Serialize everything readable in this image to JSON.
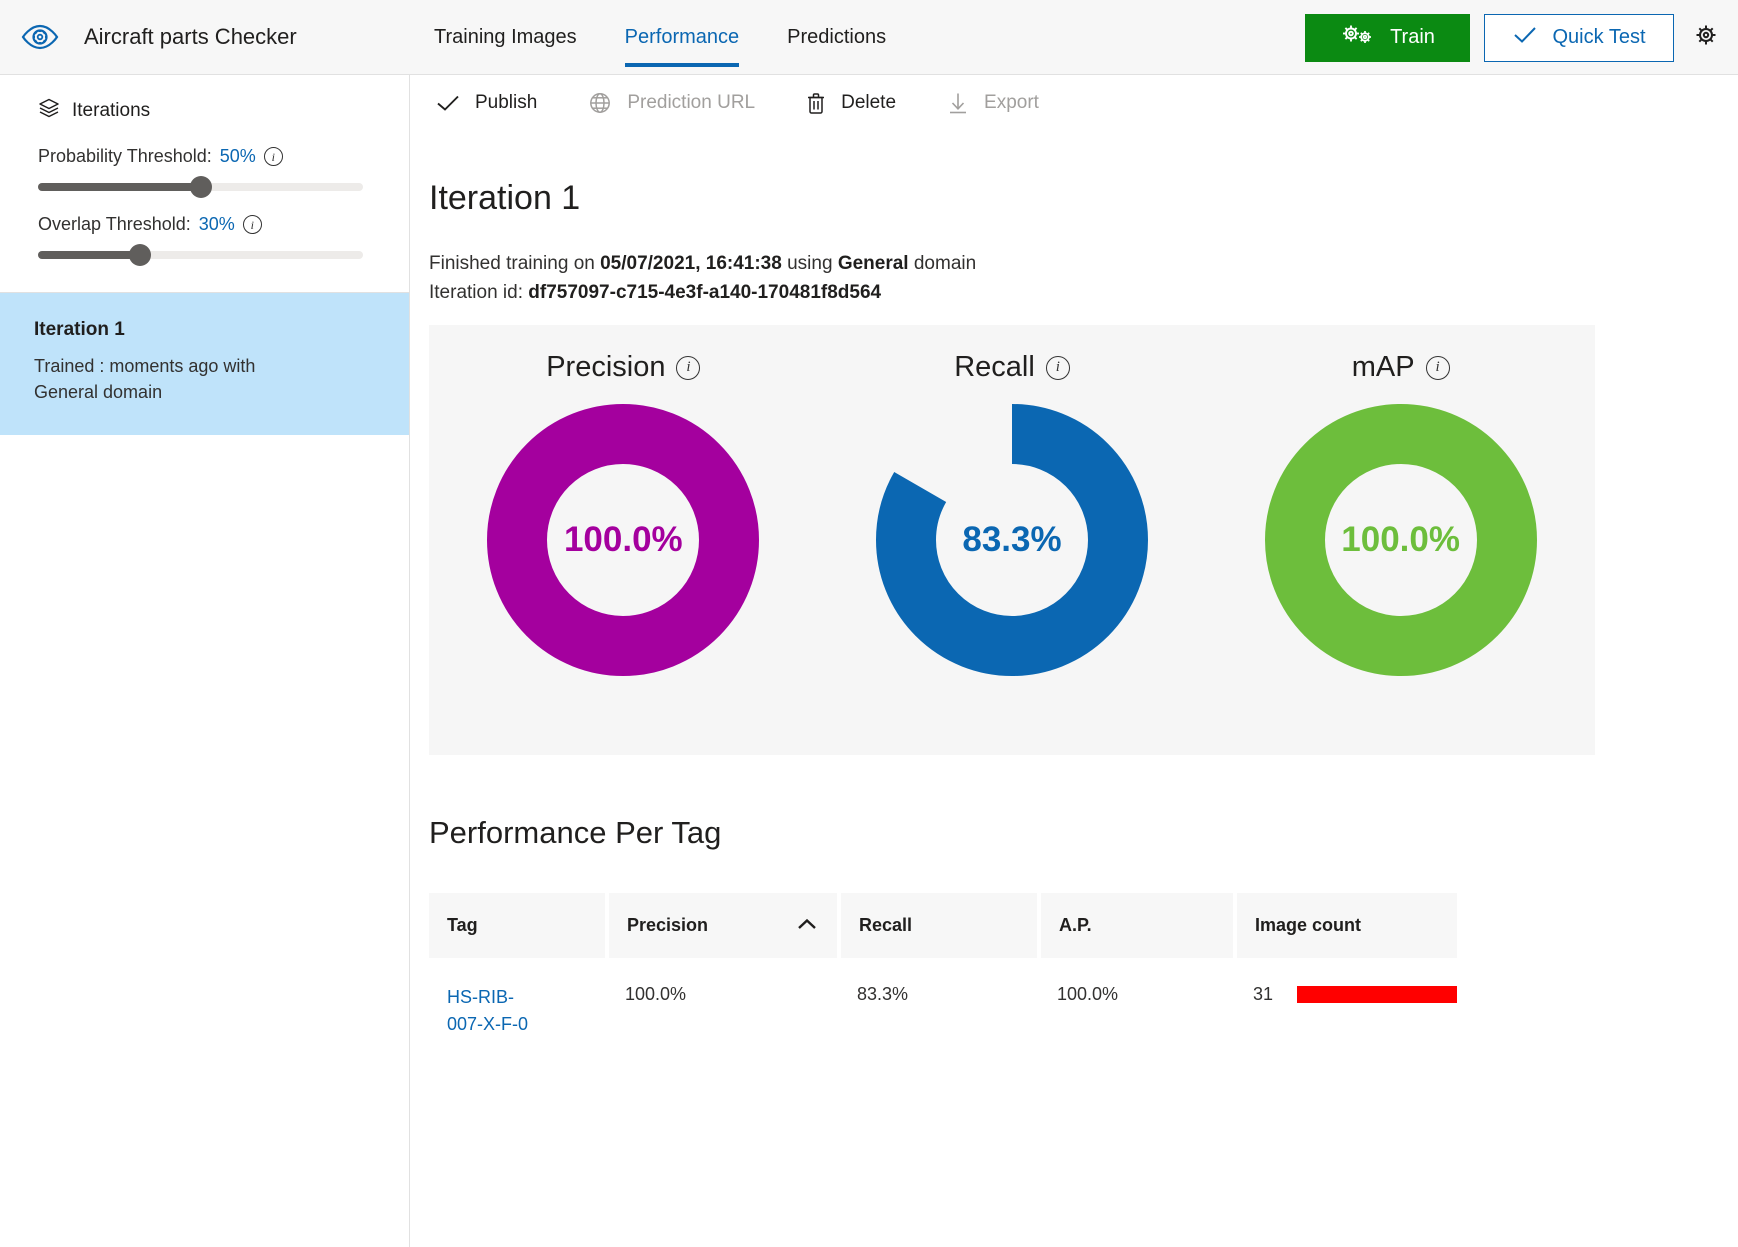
{
  "header": {
    "logo_icon": "eye-gear-icon",
    "project_title": "Aircraft parts Checker",
    "tabs": [
      {
        "label": "Training Images",
        "active": false
      },
      {
        "label": "Performance",
        "active": true
      },
      {
        "label": "Predictions",
        "active": false
      }
    ],
    "train_button": {
      "label": "Train",
      "icon": "gears-icon",
      "color": "#0b8a12"
    },
    "quick_test_button": {
      "label": "Quick Test",
      "icon": "checkmark-icon",
      "color": "#0b67b2"
    },
    "settings_icon": "gear-icon"
  },
  "sidebar": {
    "title": "Iterations",
    "title_icon": "layers-icon",
    "probability": {
      "label": "Probability Threshold:",
      "value": "50%",
      "percent": 50,
      "info_icon": "info-icon"
    },
    "overlap": {
      "label": "Overlap Threshold:",
      "value": "30%",
      "percent": 30,
      "info_icon": "info-icon"
    },
    "iterations": [
      {
        "name": "Iteration 1",
        "subtitle": "Trained : moments ago with General domain",
        "selected": true
      }
    ]
  },
  "toolbar": {
    "publish": {
      "label": "Publish",
      "icon": "checkmark-icon",
      "disabled": false
    },
    "prediction_url": {
      "label": "Prediction URL",
      "icon": "globe-icon",
      "disabled": true
    },
    "delete": {
      "label": "Delete",
      "icon": "trash-icon",
      "disabled": false
    },
    "export": {
      "label": "Export",
      "icon": "download-icon",
      "disabled": true
    }
  },
  "main": {
    "page_title": "Iteration 1",
    "finished_prefix": "Finished training on ",
    "finished_date": "05/07/2021, 16:41:38",
    "finished_mid": " using ",
    "domain": "General",
    "finished_suffix": " domain",
    "iteration_id_label": "Iteration id: ",
    "iteration_id": "df757097-c715-4e3f-a140-170481f8d564",
    "section_title": "Performance Per Tag"
  },
  "chart_data": [
    {
      "type": "pie",
      "title": "Precision",
      "value": 100.0,
      "value_label": "100.0%",
      "color": "#A4009E",
      "track_color": "#f6f6f6",
      "info_icon": "info-icon"
    },
    {
      "type": "pie",
      "title": "Recall",
      "value": 83.3,
      "value_label": "83.3%",
      "color": "#0b67b2",
      "track_color": "#f6f6f6",
      "info_icon": "info-icon"
    },
    {
      "type": "pie",
      "title": "mAP",
      "value": 100.0,
      "value_label": "100.0%",
      "color": "#6dbe3c",
      "track_color": "#f6f6f6",
      "info_icon": "info-icon"
    }
  ],
  "table": {
    "columns": [
      {
        "label": "Tag",
        "sorted": false
      },
      {
        "label": "Precision",
        "sorted": true,
        "sort_dir": "asc",
        "sort_icon": "chevron-up-icon"
      },
      {
        "label": "Recall",
        "sorted": false
      },
      {
        "label": "A.P.",
        "sorted": false
      },
      {
        "label": "Image count",
        "sorted": false
      }
    ],
    "rows": [
      {
        "tag": "HS-RIB-007-X-F-0",
        "precision": "100.0%",
        "recall": "83.3%",
        "ap": "100.0%",
        "image_count": "31",
        "bar_color": "#ff0000",
        "bar_percent": 100
      }
    ]
  }
}
